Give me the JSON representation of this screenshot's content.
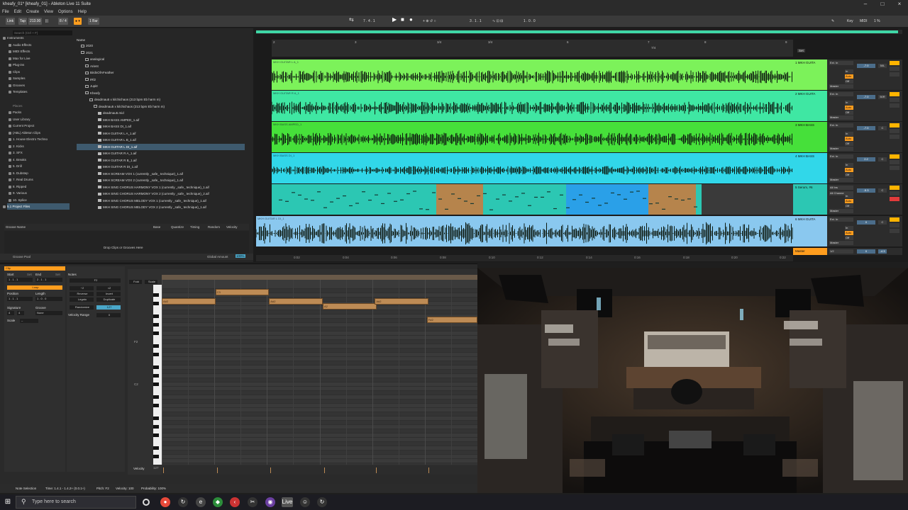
{
  "window": {
    "title": "kheafy_01* [kheafy_01] - Ableton Live 11 Suite"
  },
  "menu": [
    "File",
    "Edit",
    "Create",
    "View",
    "Options",
    "Help"
  ],
  "control": {
    "link": "Link",
    "tap": "Tap",
    "tempo": "213.00",
    "signature": "8 / 4",
    "quantize": "1 Bar",
    "position": "7 . 4 . 1",
    "loop_start": "3 . 1 . 1",
    "loop_length": "1 . 0 . 0",
    "key": "Key",
    "midi": "MIDI",
    "cpu": "1 %"
  },
  "browser": {
    "search_placeholder": "Search (Ctrl + F)",
    "categories": [
      "Instruments",
      "Audio Effects",
      "MIDI Effects",
      "Max for Live",
      "Plug-ins",
      "Clips",
      "Samples",
      "Grooves",
      "Templates"
    ],
    "places_title": "Places",
    "places": [
      "Packs",
      "User Library",
      "Current Project",
      "(ABL) Ableton Clips",
      "1. House Electro Techno",
      "2. Kicks",
      "3. SFX",
      "4. Breaks",
      "5. Drill",
      "6. Dubstep",
      "7. Real Drums",
      "8. Ripped",
      "9. Various",
      "10. Splice",
      "5.1 Project Files"
    ],
    "column_title": "Name",
    "files": [
      {
        "name": "2020",
        "type": "folder",
        "indent": 0
      },
      {
        "name": "2021",
        "type": "folder",
        "indent": 0
      },
      {
        "name": "analogical",
        "type": "folder",
        "indent": 1
      },
      {
        "name": "Arient",
        "type": "folder",
        "indent": 1
      },
      {
        "name": "BirdsOfAFeather",
        "type": "folder",
        "indent": 1
      },
      {
        "name": "IRl2",
        "type": "folder",
        "indent": 1
      },
      {
        "name": "Jupitr",
        "type": "folder",
        "indent": 1
      },
      {
        "name": "Kheafy",
        "type": "folder",
        "indent": 1
      },
      {
        "name": "deadmau5 x kilchichaos (213 bpm Eb harm m)",
        "type": "folder",
        "indent": 2
      },
      {
        "name": "deadmau5 x kilchichaos (213 bpm Eb harm m)",
        "type": "folder",
        "indent": 3
      },
      {
        "name": "deadmau5.mid",
        "type": "file",
        "indent": 4
      },
      {
        "name": "MKH BASS AMPED_1.aif",
        "type": "file",
        "indent": 4
      },
      {
        "name": "MKH BASS DI_1.aif",
        "type": "file",
        "indent": 4
      },
      {
        "name": "MKH GUITAR L A_1.aif",
        "type": "file",
        "indent": 4
      },
      {
        "name": "MKH GUITAR L B_1.aif",
        "type": "file",
        "indent": 4
      },
      {
        "name": "MKH GUITAR L DI_1.aif",
        "type": "file",
        "indent": 4
      },
      {
        "name": "MKH GUITAR R A_1.aif",
        "type": "file",
        "indent": 4
      },
      {
        "name": "MKH GUITAR R B_1.aif",
        "type": "file",
        "indent": 4
      },
      {
        "name": "MKH GUITAR R DI_1.aif",
        "type": "file",
        "indent": 4
      },
      {
        "name": "MKH SCREAM VOX 1 (currently _safe_ technique)_1.aif",
        "type": "file",
        "indent": 4
      },
      {
        "name": "MKH SCREAM VOX 2 (currently _safe_ technique)_1.aif",
        "type": "file",
        "indent": 4
      },
      {
        "name": "MKH SING CHORUS HARMONY VOX 1 (currently _safe_ technique)_1.aif",
        "type": "file",
        "indent": 4
      },
      {
        "name": "MKH SING CHORUS HARMONY VOX 2 (currently _safe_ technique)_2.aif",
        "type": "file",
        "indent": 4
      },
      {
        "name": "MKH SING CHORUS MELODY VOX 1 (currently _safe_ technique)_1.aif",
        "type": "file",
        "indent": 4
      },
      {
        "name": "MKH SING CHORUS MELODY VOX 2 (currently _safe_ technique)_1.aif",
        "type": "file",
        "indent": 4
      }
    ],
    "groove": {
      "headers": [
        "Groove Name",
        "Base",
        "Quantize",
        "Timing",
        "Random",
        "Velocity"
      ],
      "drop_hint": "Drop Clips or Grooves Here",
      "pool_label": "Groove Pool",
      "global_amount_label": "Global Amount",
      "global_amount": "100%"
    }
  },
  "arrangement": {
    "ruler": [
      "2",
      "3",
      "3/4",
      "3/4",
      "6",
      "7",
      "7/4",
      "8",
      "9"
    ],
    "set_label": "Set",
    "tracks": [
      {
        "clip": "MKH GUITAR L A_1",
        "name": "1 MKH GUITA",
        "input": "Ext. In",
        "vol": "-7.0",
        "pan": "50L",
        "color": "#7cf25a",
        "header": "#7cf25a"
      },
      {
        "clip": "MKH GUITAR R A_1",
        "name": "2 MKH GUITA",
        "input": "Ext. In",
        "vol": "-7.0",
        "pan": "50R",
        "color": "#3fe7a3",
        "header": "#3fe7a3"
      },
      {
        "clip": "MKH BASS AMPED_1",
        "name": "3 MKH BASS",
        "input": "Ext. In",
        "vol": "-7.0",
        "pan": "C",
        "color": "#46e03a",
        "header": "#46e03a"
      },
      {
        "clip": "MKH BASS DI_1",
        "name": "4 MKH BASS",
        "input": "Ext. In",
        "vol": "2.2",
        "pan": "C",
        "color": "#31d7e9",
        "header": "#31d7e9"
      },
      {
        "clip": "",
        "name": "5 Serum, #6",
        "input": "All Ins",
        "input2": "All Channe",
        "vol": "-5.3",
        "pan": "C",
        "color": "#2cc7b3",
        "header": "#2cc7b3"
      },
      {
        "clip": "MKH GUITAR L DI_1",
        "name": "6 MKH GUITA",
        "input": "Ext. In",
        "vol": "0",
        "pan": "C",
        "color": "#8ac8ef",
        "header": "#8ac8ef"
      }
    ],
    "monitor": [
      "In",
      "Auto",
      "Off"
    ],
    "master": {
      "name": "Master",
      "quant": "1/2",
      "vol": "0",
      "pan": "-4.3"
    },
    "timeline": [
      "0:02",
      "0:04",
      "0:06",
      "0:08",
      "0:10",
      "0:12",
      "0:14",
      "0:16",
      "0:18",
      "0:20",
      "0:22"
    ],
    "colors": {
      "midi_brown": "#b6844c",
      "midi_blue": "#2aa0e8"
    }
  },
  "clipview": {
    "header": "Clip",
    "start_label": "Start",
    "set_label": "Set",
    "end_label": "End",
    "start": "1 . 1 . 1",
    "end": "2 . 1 . 1",
    "loop": "Loop",
    "position_label": "Position",
    "length_label": "Length",
    "position": "1 . 1 . 1",
    "length": "1 . 0 . 0",
    "signature_label": "Signature",
    "groove_label": "Groove",
    "sig_num": "4",
    "sig_den": "4",
    "groove": "None",
    "scale_label": "Scale",
    "notes_header": "Notes",
    "transpose_down": "÷2",
    "transpose_up": "×2",
    "pitch": "F2",
    "reverse": "Reverse",
    "invert": "Invert",
    "legato": "Legato",
    "duplicate": "Duplicate",
    "randomize": "Randomize",
    "randomize_val": "127",
    "velocity_range": "Velocity Range",
    "velocity_range_val": "0",
    "fold": "Fold",
    "scale_btn": "Scale",
    "bars": [
      "1.1.2",
      "1.2",
      "1.2.3",
      "1.3",
      "1.3.2"
    ],
    "key_labels": [
      "F2",
      "C2"
    ],
    "notes": [
      {
        "label": "A#2",
        "start": 0.0,
        "dur": 0.17,
        "pitch_row": 3
      },
      {
        "label": "C3",
        "start": 0.17,
        "dur": 0.17,
        "pitch_row": 1
      },
      {
        "label": "A#2",
        "start": 0.34,
        "dur": 0.17,
        "pitch_row": 3
      },
      {
        "label": "A2",
        "start": 0.51,
        "dur": 0.17,
        "pitch_row": 4
      },
      {
        "label": "A#2",
        "start": 0.675,
        "dur": 0.17,
        "pitch_row": 3
      },
      {
        "label": "F#2",
        "start": 0.84,
        "dur": 0.16,
        "pitch_row": 7
      }
    ],
    "velocity_label": "Velocity",
    "velocity_max": "127"
  },
  "status": {
    "left": "Note Selection",
    "time": "Time: 1.4.1 - 1.4.2+ (0.0.1+)",
    "pitch": "Pitch: F2",
    "velocity": "Velocity: 100",
    "probability": "Probability: 100%"
  },
  "taskbar": {
    "search_placeholder": "Type here to search"
  }
}
